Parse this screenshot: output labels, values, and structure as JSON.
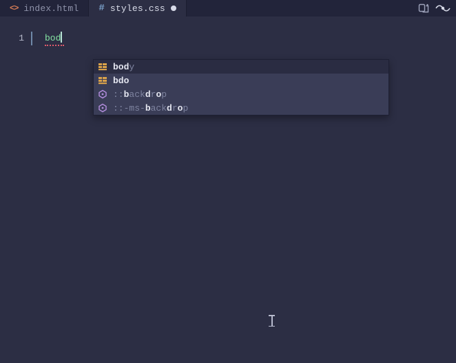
{
  "tabs": [
    {
      "icon": "<>",
      "label": "index.html",
      "dirty": false
    },
    {
      "icon": "#",
      "label": "styles.css",
      "dirty": true
    }
  ],
  "active_tab": 1,
  "editor": {
    "line_number": "1",
    "typed_text": "bod"
  },
  "suggestions": {
    "selected": 0,
    "items": [
      {
        "kind": "struct",
        "segments": [
          [
            "b",
            "bod"
          ],
          [
            "dim",
            "y"
          ]
        ]
      },
      {
        "kind": "struct",
        "segments": [
          [
            "b",
            "bdo"
          ]
        ]
      },
      {
        "kind": "hex",
        "segments": [
          [
            "dim",
            "::"
          ],
          [
            "b",
            "b"
          ],
          [
            "dim",
            "ack"
          ],
          [
            "b",
            "d"
          ],
          [
            "dim",
            "r"
          ],
          [
            "b",
            "o"
          ],
          [
            "dim",
            "p"
          ]
        ]
      },
      {
        "kind": "hex",
        "segments": [
          [
            "dim",
            "::-ms-"
          ],
          [
            "b",
            "b"
          ],
          [
            "dim",
            "ack"
          ],
          [
            "b",
            "d"
          ],
          [
            "dim",
            "r"
          ],
          [
            "b",
            "o"
          ],
          [
            "dim",
            "p"
          ]
        ]
      }
    ]
  }
}
